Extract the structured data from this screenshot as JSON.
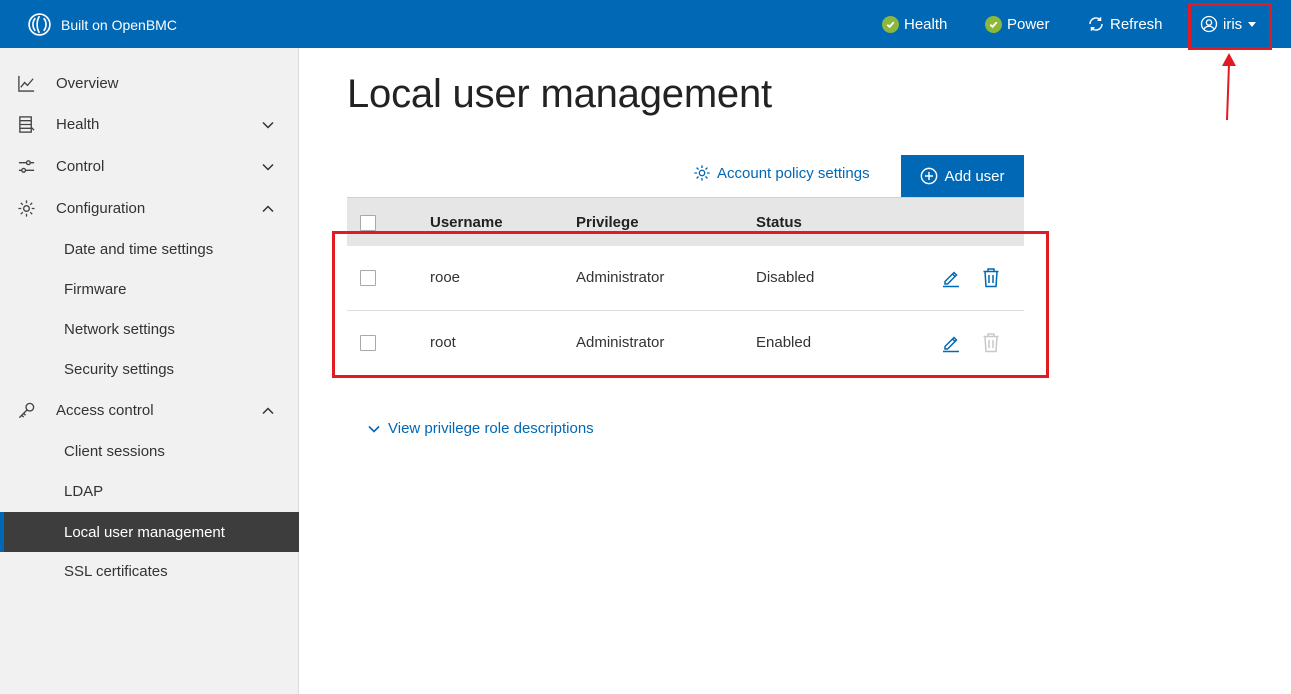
{
  "header": {
    "brand": "Built on OpenBMC",
    "health": "Health",
    "power": "Power",
    "refresh": "Refresh",
    "user": "iris"
  },
  "sidebar": {
    "items": [
      {
        "label": "Overview",
        "icon": "chart-line-icon"
      },
      {
        "label": "Health",
        "icon": "server-list-icon",
        "expanded": false
      },
      {
        "label": "Control",
        "icon": "sliders-icon",
        "expanded": false
      },
      {
        "label": "Configuration",
        "icon": "gear-icon",
        "expanded": true,
        "children": [
          "Date and time settings",
          "Firmware",
          "Network settings",
          "Security settings"
        ]
      },
      {
        "label": "Access control",
        "icon": "key-icon",
        "expanded": true,
        "children": [
          "Client sessions",
          "LDAP",
          "Local user management",
          "SSL certificates"
        ]
      }
    ],
    "active": "Local user management"
  },
  "main": {
    "title": "Local user management",
    "account_policy": "Account policy settings",
    "add_user": "Add user",
    "table": {
      "headers": [
        "Username",
        "Privilege",
        "Status"
      ],
      "rows": [
        {
          "username": "rooe",
          "privilege": "Administrator",
          "status": "Disabled",
          "delete_enabled": true
        },
        {
          "username": "root",
          "privilege": "Administrator",
          "status": "Enabled",
          "delete_enabled": false
        }
      ]
    },
    "privilege_toggle": "View privilege role descriptions"
  },
  "colors": {
    "brand_blue": "#0068b5",
    "status_ok": "#8bb73c",
    "annotation_red": "#e01b22"
  }
}
